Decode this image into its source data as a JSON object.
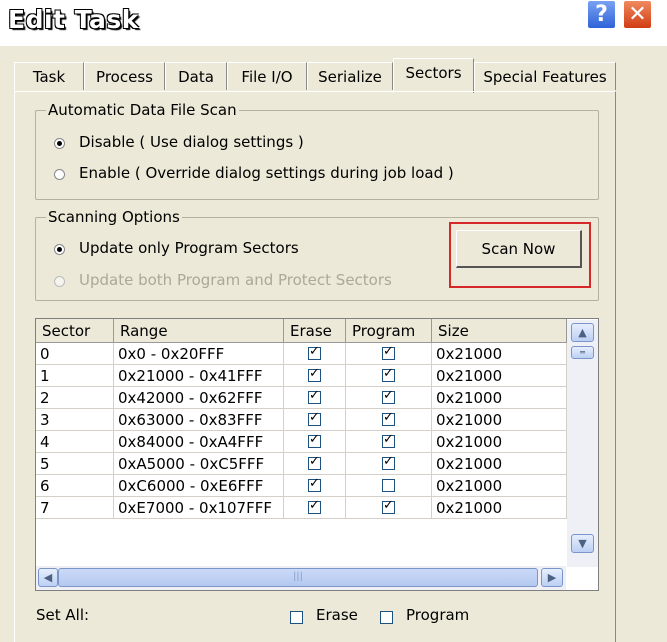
{
  "window": {
    "title": "Edit Task",
    "help_glyph": "?",
    "close_glyph": "✕"
  },
  "tabs": [
    {
      "label": "Task",
      "active": false
    },
    {
      "label": "Process",
      "active": false
    },
    {
      "label": "Data",
      "active": false
    },
    {
      "label": "File I/O",
      "active": false
    },
    {
      "label": "Serialize",
      "active": false
    },
    {
      "label": "Sectors",
      "active": true
    },
    {
      "label": "Special Features",
      "active": false
    }
  ],
  "auto_scan": {
    "legend": "Automatic Data File Scan",
    "options": [
      {
        "label": "Disable ( Use dialog settings )",
        "selected": true
      },
      {
        "label": "Enable ( Override dialog settings during job load )",
        "selected": false
      }
    ]
  },
  "scan_options": {
    "legend": "Scanning Options",
    "options": [
      {
        "label": "Update only Program Sectors",
        "selected": true,
        "enabled": true
      },
      {
        "label": "Update both Program and Protect Sectors",
        "selected": false,
        "enabled": false
      }
    ],
    "scan_button": "Scan Now"
  },
  "table": {
    "headers": [
      "Sector",
      "Range",
      "Erase",
      "Program",
      "Size"
    ],
    "rows": [
      {
        "sector": "0",
        "range": "0x0 - 0x20FFF",
        "erase": true,
        "program": true,
        "size": "0x21000"
      },
      {
        "sector": "1",
        "range": "0x21000 - 0x41FFF",
        "erase": true,
        "program": true,
        "size": "0x21000"
      },
      {
        "sector": "2",
        "range": "0x42000 - 0x62FFF",
        "erase": true,
        "program": true,
        "size": "0x21000"
      },
      {
        "sector": "3",
        "range": "0x63000 - 0x83FFF",
        "erase": true,
        "program": true,
        "size": "0x21000"
      },
      {
        "sector": "4",
        "range": "0x84000 - 0xA4FFF",
        "erase": true,
        "program": true,
        "size": "0x21000"
      },
      {
        "sector": "5",
        "range": "0xA5000 - 0xC5FFF",
        "erase": true,
        "program": true,
        "size": "0x21000"
      },
      {
        "sector": "6",
        "range": "0xC6000 - 0xE6FFF",
        "erase": true,
        "program": false,
        "size": "0x21000"
      },
      {
        "sector": "7",
        "range": "0xE7000 - 0x107FFF",
        "erase": true,
        "program": true,
        "size": "0x21000"
      }
    ]
  },
  "set_all": {
    "label": "Set All:",
    "erase_label": "Erase",
    "program_label": "Program",
    "erase": false,
    "program": false
  },
  "colors": {
    "highlight": "#d62828",
    "dialog_bg": "#ece9d8"
  }
}
